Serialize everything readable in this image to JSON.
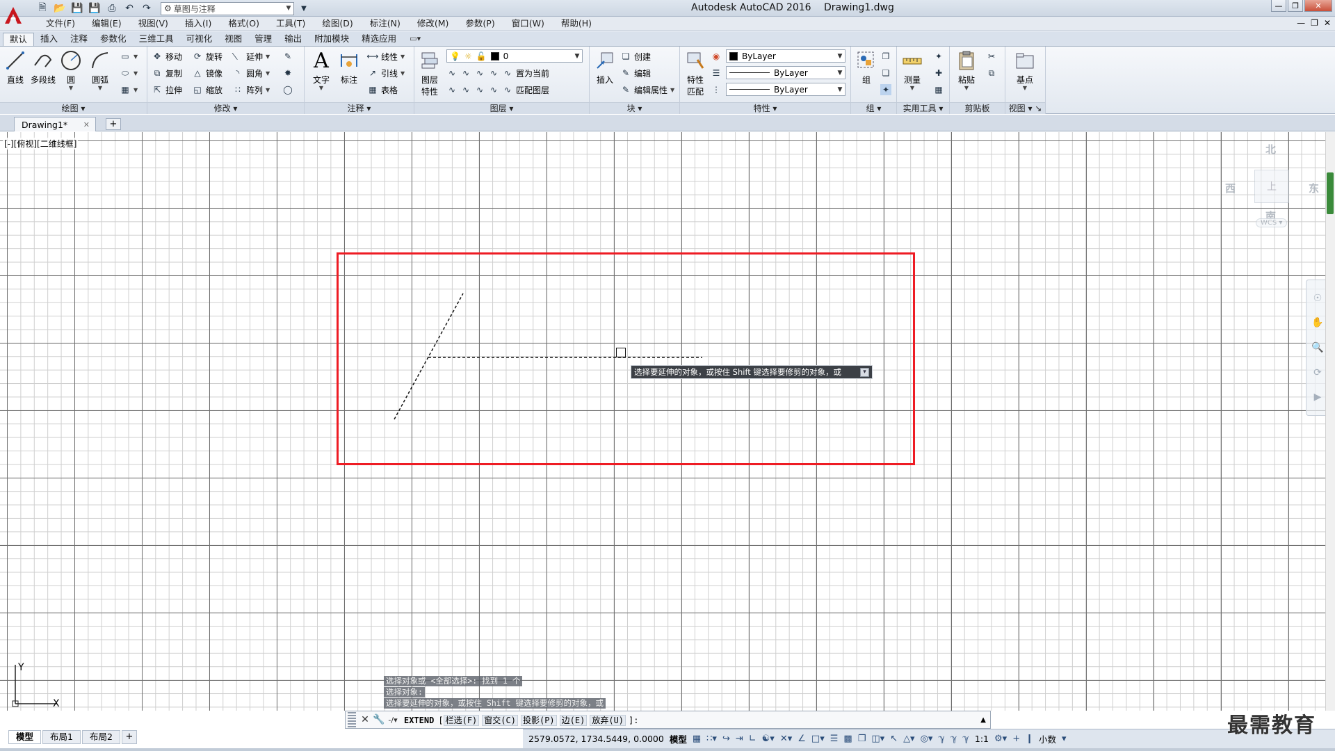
{
  "titlebar": {
    "app_name": "Autodesk AutoCAD 2016",
    "file_name": "Drawing1.dwg",
    "workspace": "草图与注释"
  },
  "menu": [
    "文件(F)",
    "编辑(E)",
    "视图(V)",
    "插入(I)",
    "格式(O)",
    "工具(T)",
    "绘图(D)",
    "标注(N)",
    "修改(M)",
    "参数(P)",
    "窗口(W)",
    "帮助(H)"
  ],
  "ribbon_tabs": [
    "默认",
    "插入",
    "注释",
    "参数化",
    "三维工具",
    "可视化",
    "视图",
    "管理",
    "输出",
    "附加模块",
    "精选应用"
  ],
  "ribbon": {
    "draw": {
      "title": "绘图",
      "line": "直线",
      "polyline": "多段线",
      "circle": "圆",
      "arc": "圆弧"
    },
    "modify": {
      "title": "修改",
      "move": "移动",
      "rotate": "旋转",
      "extend": "延伸",
      "copy": "复制",
      "mirror": "镜像",
      "fillet": "圆角",
      "stretch": "拉伸",
      "scale": "缩放",
      "array": "阵列"
    },
    "annotation": {
      "title": "注释",
      "text": "文字",
      "dimension": "标注",
      "linear": "线性",
      "leader": "引线",
      "table": "表格"
    },
    "layers": {
      "title": "图层",
      "layer_props": "图层",
      "layer_props2": "特性",
      "current_layer": "0",
      "set_current": "置为当前",
      "match_layer": "匹配图层"
    },
    "block": {
      "title": "块",
      "insert": "插入",
      "create": "创建",
      "edit": "编辑",
      "edit_attr": "编辑属性"
    },
    "properties": {
      "title": "特性",
      "match": "特性",
      "match2": "匹配",
      "color": "ByLayer",
      "linetype": "ByLayer",
      "lineweight": "ByLayer"
    },
    "groups": {
      "title": "组",
      "group": "组"
    },
    "utilities": {
      "title": "实用工具",
      "measure": "测量"
    },
    "clipboard": {
      "title": "剪贴板",
      "paste": "粘贴"
    },
    "view": {
      "title": "视图",
      "base": "基点"
    }
  },
  "file_tab": "Drawing1*",
  "viewport_label": "[-][俯视][二维线框]",
  "tooltip": "选择要延伸的对象，或按住 Shift 键选择要修剪的对象，或",
  "viewcube": {
    "north": "北",
    "south": "南",
    "east": "东",
    "west": "西",
    "top": "上",
    "wcs": "WCS"
  },
  "ucs": {
    "x": "X",
    "y": "Y"
  },
  "command_history": [
    "选择对象或 <全部选择>:  找到 1 个",
    "选择对象:",
    "选择要延伸的对象，或按住 Shift 键选择要修剪的对象，或"
  ],
  "command_line": {
    "command": "EXTEND",
    "options": [
      "栏选(F)",
      "窗交(C)",
      "投影(P)",
      "边(E)",
      "放弃(U)"
    ],
    "suffix": "]:"
  },
  "layout_tabs": [
    "模型",
    "布局1",
    "布局2"
  ],
  "status": {
    "coords": "2579.0572, 1734.5449, 0.0000",
    "model": "模型",
    "scale": "1:1",
    "units": "小数"
  },
  "watermark": "最需教育",
  "colors": {
    "annotation_rect": "#ee1c24",
    "tooltip_bg": "#3c4046",
    "grid_major": "#6f6f6f",
    "grid_minor": "#cfcfcf"
  }
}
